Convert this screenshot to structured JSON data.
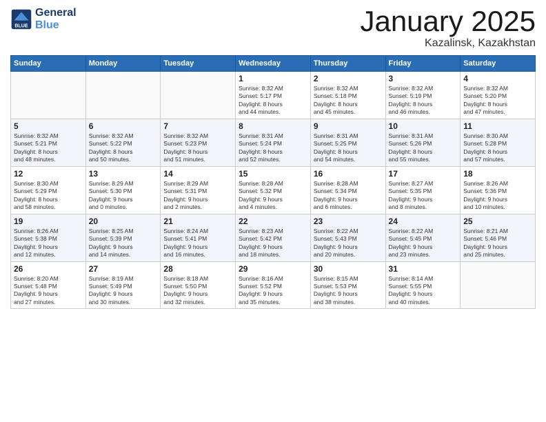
{
  "header": {
    "logo_line1": "General",
    "logo_line2": "Blue",
    "title": "January 2025",
    "subtitle": "Kazalinsk, Kazakhstan"
  },
  "weekdays": [
    "Sunday",
    "Monday",
    "Tuesday",
    "Wednesday",
    "Thursday",
    "Friday",
    "Saturday"
  ],
  "weeks": [
    [
      {
        "num": "",
        "info": ""
      },
      {
        "num": "",
        "info": ""
      },
      {
        "num": "",
        "info": ""
      },
      {
        "num": "1",
        "info": "Sunrise: 8:32 AM\nSunset: 5:17 PM\nDaylight: 8 hours\nand 44 minutes."
      },
      {
        "num": "2",
        "info": "Sunrise: 8:32 AM\nSunset: 5:18 PM\nDaylight: 8 hours\nand 45 minutes."
      },
      {
        "num": "3",
        "info": "Sunrise: 8:32 AM\nSunset: 5:19 PM\nDaylight: 8 hours\nand 46 minutes."
      },
      {
        "num": "4",
        "info": "Sunrise: 8:32 AM\nSunset: 5:20 PM\nDaylight: 8 hours\nand 47 minutes."
      }
    ],
    [
      {
        "num": "5",
        "info": "Sunrise: 8:32 AM\nSunset: 5:21 PM\nDaylight: 8 hours\nand 48 minutes."
      },
      {
        "num": "6",
        "info": "Sunrise: 8:32 AM\nSunset: 5:22 PM\nDaylight: 8 hours\nand 50 minutes."
      },
      {
        "num": "7",
        "info": "Sunrise: 8:32 AM\nSunset: 5:23 PM\nDaylight: 8 hours\nand 51 minutes."
      },
      {
        "num": "8",
        "info": "Sunrise: 8:31 AM\nSunset: 5:24 PM\nDaylight: 8 hours\nand 52 minutes."
      },
      {
        "num": "9",
        "info": "Sunrise: 8:31 AM\nSunset: 5:25 PM\nDaylight: 8 hours\nand 54 minutes."
      },
      {
        "num": "10",
        "info": "Sunrise: 8:31 AM\nSunset: 5:26 PM\nDaylight: 8 hours\nand 55 minutes."
      },
      {
        "num": "11",
        "info": "Sunrise: 8:30 AM\nSunset: 5:28 PM\nDaylight: 8 hours\nand 57 minutes."
      }
    ],
    [
      {
        "num": "12",
        "info": "Sunrise: 8:30 AM\nSunset: 5:29 PM\nDaylight: 8 hours\nand 58 minutes."
      },
      {
        "num": "13",
        "info": "Sunrise: 8:29 AM\nSunset: 5:30 PM\nDaylight: 9 hours\nand 0 minutes."
      },
      {
        "num": "14",
        "info": "Sunrise: 8:29 AM\nSunset: 5:31 PM\nDaylight: 9 hours\nand 2 minutes."
      },
      {
        "num": "15",
        "info": "Sunrise: 8:28 AM\nSunset: 5:32 PM\nDaylight: 9 hours\nand 4 minutes."
      },
      {
        "num": "16",
        "info": "Sunrise: 8:28 AM\nSunset: 5:34 PM\nDaylight: 9 hours\nand 6 minutes."
      },
      {
        "num": "17",
        "info": "Sunrise: 8:27 AM\nSunset: 5:35 PM\nDaylight: 9 hours\nand 8 minutes."
      },
      {
        "num": "18",
        "info": "Sunrise: 8:26 AM\nSunset: 5:36 PM\nDaylight: 9 hours\nand 10 minutes."
      }
    ],
    [
      {
        "num": "19",
        "info": "Sunrise: 8:26 AM\nSunset: 5:38 PM\nDaylight: 9 hours\nand 12 minutes."
      },
      {
        "num": "20",
        "info": "Sunrise: 8:25 AM\nSunset: 5:39 PM\nDaylight: 9 hours\nand 14 minutes."
      },
      {
        "num": "21",
        "info": "Sunrise: 8:24 AM\nSunset: 5:41 PM\nDaylight: 9 hours\nand 16 minutes."
      },
      {
        "num": "22",
        "info": "Sunrise: 8:23 AM\nSunset: 5:42 PM\nDaylight: 9 hours\nand 18 minutes."
      },
      {
        "num": "23",
        "info": "Sunrise: 8:22 AM\nSunset: 5:43 PM\nDaylight: 9 hours\nand 20 minutes."
      },
      {
        "num": "24",
        "info": "Sunrise: 8:22 AM\nSunset: 5:45 PM\nDaylight: 9 hours\nand 23 minutes."
      },
      {
        "num": "25",
        "info": "Sunrise: 8:21 AM\nSunset: 5:46 PM\nDaylight: 9 hours\nand 25 minutes."
      }
    ],
    [
      {
        "num": "26",
        "info": "Sunrise: 8:20 AM\nSunset: 5:48 PM\nDaylight: 9 hours\nand 27 minutes."
      },
      {
        "num": "27",
        "info": "Sunrise: 8:19 AM\nSunset: 5:49 PM\nDaylight: 9 hours\nand 30 minutes."
      },
      {
        "num": "28",
        "info": "Sunrise: 8:18 AM\nSunset: 5:50 PM\nDaylight: 9 hours\nand 32 minutes."
      },
      {
        "num": "29",
        "info": "Sunrise: 8:16 AM\nSunset: 5:52 PM\nDaylight: 9 hours\nand 35 minutes."
      },
      {
        "num": "30",
        "info": "Sunrise: 8:15 AM\nSunset: 5:53 PM\nDaylight: 9 hours\nand 38 minutes."
      },
      {
        "num": "31",
        "info": "Sunrise: 8:14 AM\nSunset: 5:55 PM\nDaylight: 9 hours\nand 40 minutes."
      },
      {
        "num": "",
        "info": ""
      }
    ]
  ]
}
